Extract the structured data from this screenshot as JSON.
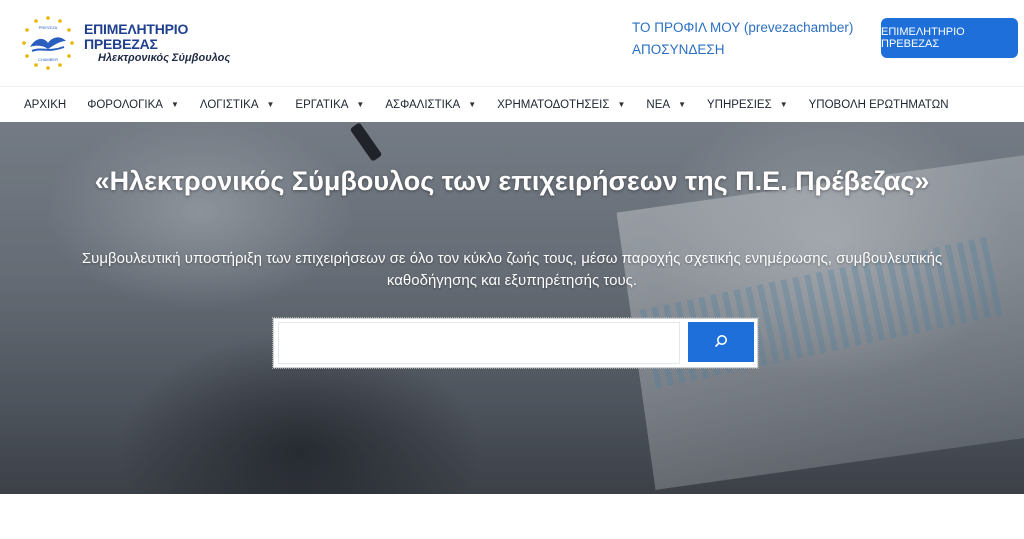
{
  "header": {
    "logo": {
      "title": "ΕΠΙΜΕΛΗΤΗΡΙΟ ΠΡΕΒΕΖΑΣ",
      "subtitle": "Ηλεκτρονικός Σύμβουλος",
      "emblem_text_top": "PREVEZA",
      "emblem_text_bottom": "CHAMBER"
    },
    "account": {
      "profile_label": "ΤΟ ΠΡΟΦΙΛ ΜΟΥ (prevezachamber)",
      "logout_label": "ΑΠΟΣΥΝΔΕΣΗ"
    },
    "chamber_button_label": "ΕΠΙΜΕΛΗΤΗΡΙΟ ΠΡΕΒΕΖΑΣ"
  },
  "nav": {
    "items": [
      {
        "label": "ΑΡΧΙΚΗ",
        "has_dropdown": false
      },
      {
        "label": "ΦΟΡΟΛΟΓΙΚΑ",
        "has_dropdown": true
      },
      {
        "label": "ΛΟΓΙΣΤΙΚΑ",
        "has_dropdown": true
      },
      {
        "label": "ΕΡΓΑΤΙΚΑ",
        "has_dropdown": true
      },
      {
        "label": "ΑΣΦΑΛΙΣΤΙΚΑ",
        "has_dropdown": true
      },
      {
        "label": "ΧΡΗΜΑΤΟΔΟΤΗΣΕΙΣ",
        "has_dropdown": true
      },
      {
        "label": "ΝΕΑ",
        "has_dropdown": true
      },
      {
        "label": "ΥΠΗΡΕΣΙΕΣ",
        "has_dropdown": true
      },
      {
        "label": "ΥΠΟΒΟΛΗ ΕΡΩΤΗΜΑΤΩΝ",
        "has_dropdown": false
      }
    ]
  },
  "hero": {
    "title": "«Ηλεκτρονικός Σύμβουλος των επιχειρήσεων της Π.Ε. Πρέβεζας»",
    "description_line1": "Συμβουλευτική υποστήριξη των επιχειρήσεων σε όλο τον κύκλο ζωής τους, μέσω παροχής σχετικής ενημέρωσης, συμβουλευτικής",
    "description_line2": "καθοδήγησης και εξυπηρέτησής τους.",
    "search": {
      "value": "",
      "placeholder": "",
      "button_icon": "search-icon"
    }
  },
  "colors": {
    "accent": "#1e6fd9",
    "link": "#2b6fc2",
    "logo_blue": "#1f3f8f",
    "star_gold": "#e8b400"
  }
}
